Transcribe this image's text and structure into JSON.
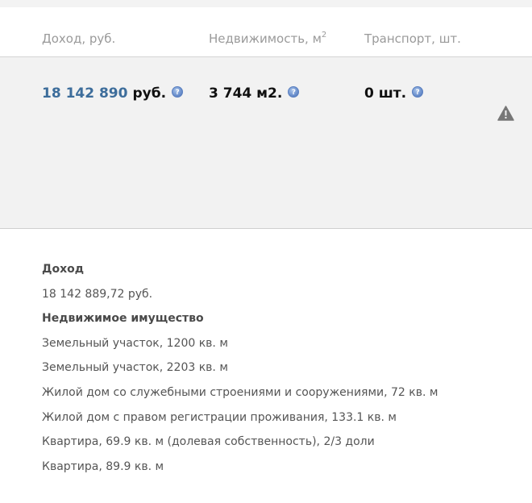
{
  "header": {
    "income": "Доход, руб.",
    "realty": "Недвижимость, м",
    "realty_sup": "2",
    "transport": "Транспорт, шт."
  },
  "values": {
    "income_number": "18 142 890",
    "income_unit": "руб.",
    "realty": "3 744 м2.",
    "transport": "0 шт."
  },
  "icons": {
    "help": "help-icon",
    "warning": "warning-icon"
  },
  "details": {
    "income_title": "Доход",
    "income_value": "18 142 889,72 руб.",
    "realty_title": "Недвижимое имущество",
    "realty_items": [
      "Земельный участок, 1200 кв. м",
      "Земельный участок, 2203 кв. м",
      "Жилой дом со служебными строениями и сооружениями, 72 кв. м",
      "Жилой дом с правом регистрации проживания, 133.1 кв. м",
      "Квартира, 69.9 кв. м (долевая собственность), 2/3 доли",
      "Квартира, 89.9 кв. м"
    ]
  },
  "colors": {
    "link": "#3d6d9b",
    "help_icon": "#6f93cf",
    "panel_bg": "#f2f2f2"
  }
}
